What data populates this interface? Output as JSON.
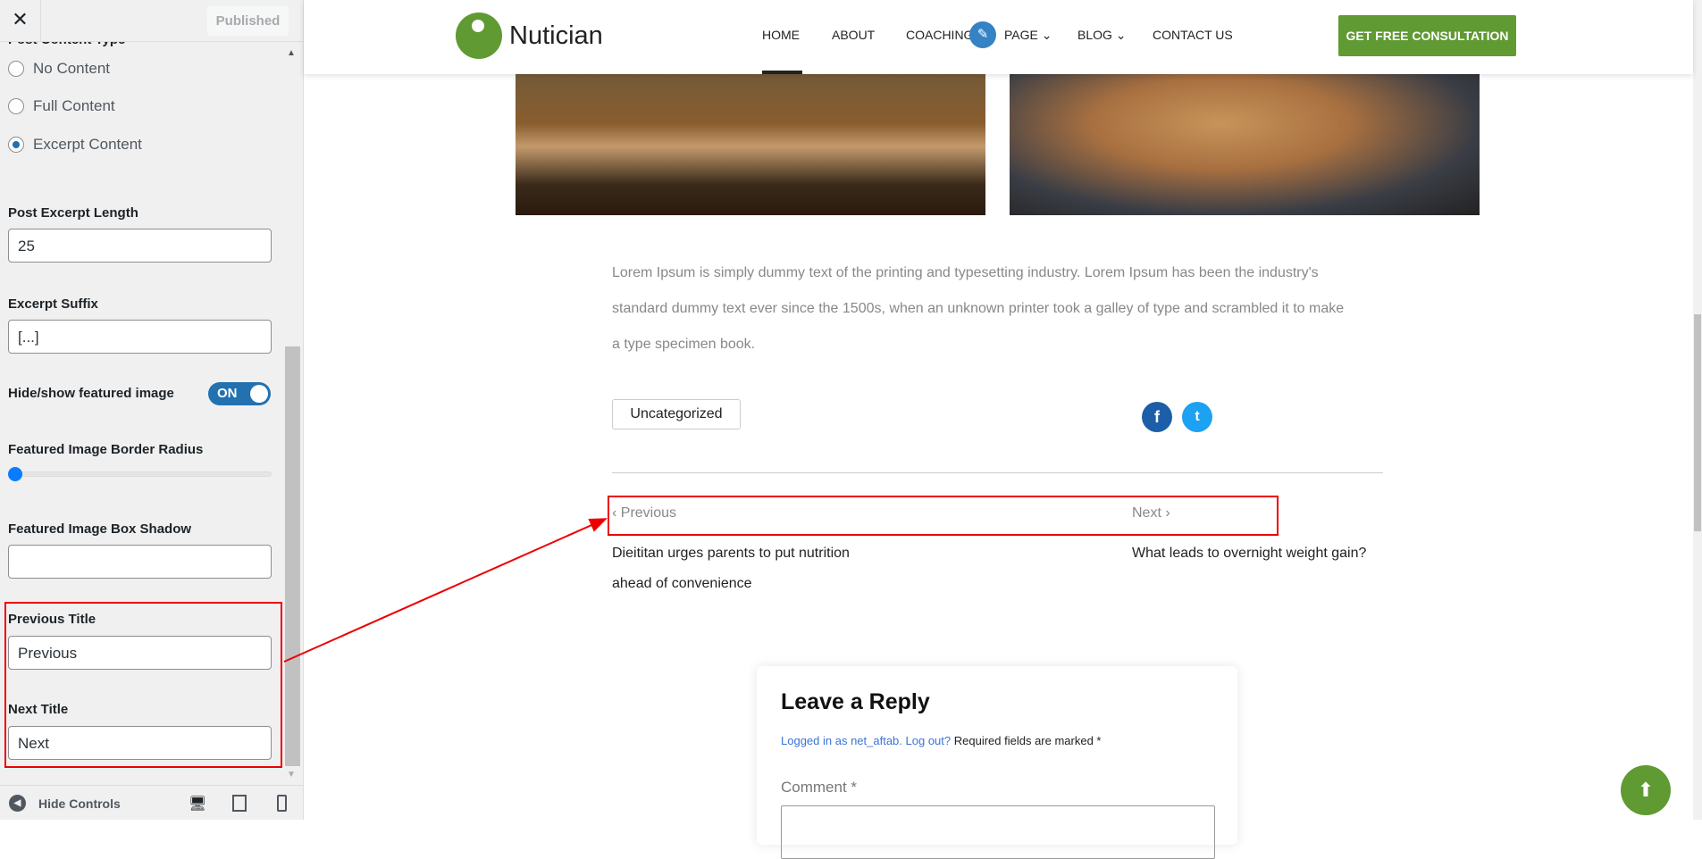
{
  "sidebar": {
    "close_label": "✕",
    "published_label": "Published",
    "section_title": "Post Content Type",
    "radios": [
      {
        "label": "No Content",
        "checked": false
      },
      {
        "label": "Full Content",
        "checked": false
      },
      {
        "label": "Excerpt Content",
        "checked": true
      }
    ],
    "excerpt_length": {
      "label": "Post Excerpt Length",
      "value": "25"
    },
    "excerpt_suffix": {
      "label": "Excerpt Suffix",
      "value": "[...]"
    },
    "featured_toggle": {
      "label": "Hide/show featured image",
      "value": "ON"
    },
    "border_radius": {
      "label": "Featured Image Border Radius",
      "value": 0
    },
    "box_shadow": {
      "label": "Featured Image Box Shadow",
      "value": ""
    },
    "previous_title": {
      "label": "Previous Title",
      "value": "Previous"
    },
    "next_title": {
      "label": "Next Title",
      "value": "Next"
    },
    "hide_controls": "Hide Controls"
  },
  "header": {
    "logo": "Nutician",
    "nav": [
      "HOME",
      "ABOUT",
      "COACHING",
      "PAGE",
      "BLOG",
      "CONTACT US"
    ],
    "cta": "GET FREE CONSULTATION"
  },
  "post": {
    "paragraph": [
      "Lorem Ipsum is simply dummy text of the printing and typesetting industry. Lorem Ipsum has been the industry's",
      "standard dummy text ever since the 1500s, when an unknown printer took a galley of type and scrambled it to make",
      "a type specimen book."
    ],
    "category": "Uncategorized",
    "prev_label": "Previous",
    "next_label": "Next",
    "prev_title_lines": [
      "Dieititan urges parents to put nutrition",
      "ahead of convenience"
    ],
    "next_title": "What leads to overnight weight gain?"
  },
  "reply": {
    "title": "Leave a Reply",
    "logged_in": "Logged in as net_aftab.",
    "log_out": "Log out?",
    "required": " Required fields are marked *",
    "comment_label": "Comment *"
  },
  "colors": {
    "brand": "#5f9a32",
    "annotation": "#ee0000",
    "facebook": "#1d5ea8",
    "twitter": "#1da1f2"
  }
}
